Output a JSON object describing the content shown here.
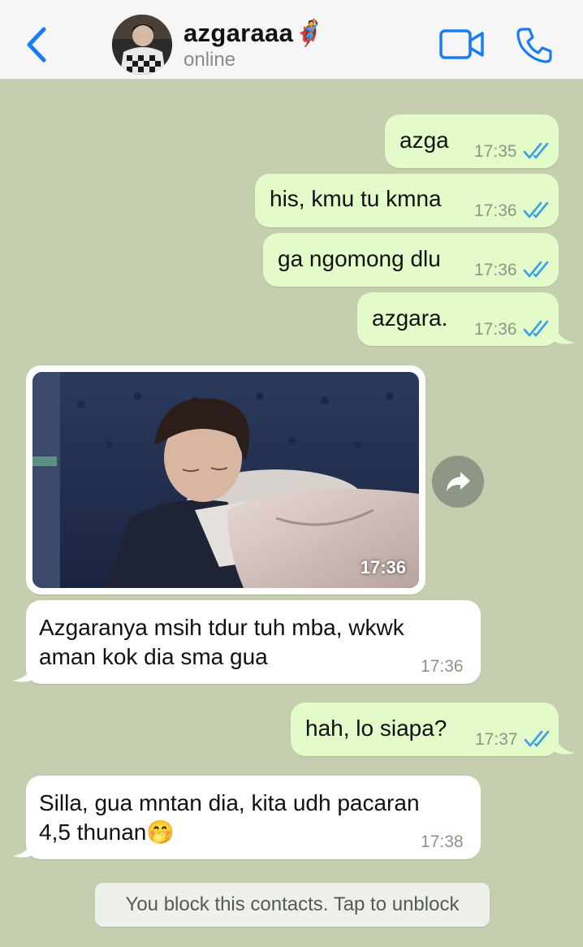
{
  "header": {
    "contact_name": "azgaraaa",
    "contact_emoji": "🦸",
    "status": "online"
  },
  "messages": [
    {
      "dir": "out",
      "text": "azga",
      "time": "17:35"
    },
    {
      "dir": "out",
      "text": "his, kmu tu kmna",
      "time": "17:36"
    },
    {
      "dir": "out",
      "text": "ga ngomong dlu",
      "time": "17:36"
    },
    {
      "dir": "out",
      "text": "azgara.",
      "time": "17:36"
    },
    {
      "dir": "in",
      "type": "photo",
      "time": "17:36"
    },
    {
      "dir": "in",
      "lines": [
        "Azgaranya msih tdur tuh mba, wkwk",
        "aman kok dia sma gua"
      ],
      "time": "17:36"
    },
    {
      "dir": "out",
      "text": "hah, lo siapa?",
      "time": "17:37"
    },
    {
      "dir": "in",
      "lines": [
        "Silla, gua mntan dia, kita udh pacaran",
        "4,5 thunan"
      ],
      "emoji": "🤭",
      "time": "17:38"
    }
  ],
  "block_notice": "You block this contacts. Tap to unblock",
  "colors": {
    "accent": "#1a7cf5",
    "outgoing_bubble": "#e2fbc9",
    "incoming_bubble": "#ffffff",
    "chat_background": "#c5cfb0",
    "read_ticks": "#3aa0e8"
  }
}
